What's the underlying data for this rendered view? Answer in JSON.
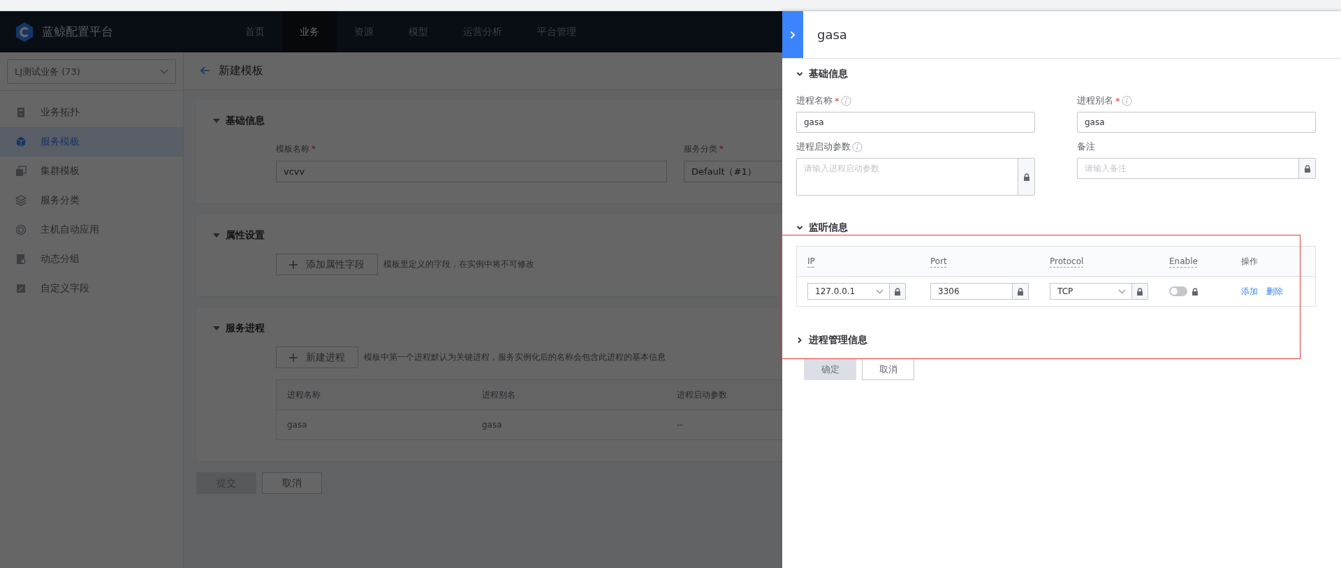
{
  "app": {
    "logo_text": "蓝鲸配置平台",
    "nav": [
      {
        "label": "首页",
        "selected": false
      },
      {
        "label": "业务",
        "selected": true
      },
      {
        "label": "资源",
        "selected": false
      },
      {
        "label": "模型",
        "selected": false
      },
      {
        "label": "运营分析",
        "selected": false
      },
      {
        "label": "平台管理",
        "selected": false
      }
    ]
  },
  "sidebar": {
    "business_select": "LJ测试业务 (73)",
    "items": [
      {
        "label": "业务拓扑",
        "selected": false
      },
      {
        "label": "服务模板",
        "selected": true
      },
      {
        "label": "集群模板",
        "selected": false
      },
      {
        "label": "服务分类",
        "selected": false
      },
      {
        "label": "主机自动应用",
        "selected": false
      },
      {
        "label": "动态分组",
        "selected": false
      },
      {
        "label": "自定义字段",
        "selected": false
      }
    ]
  },
  "page": {
    "title": "新建模板",
    "basic": {
      "title": "基础信息",
      "expanded": true,
      "fields": [
        {
          "label": "模板名称",
          "mark": "*",
          "value": "vcvv"
        },
        {
          "label": "服务分类",
          "mark": "*",
          "value": "Default（#1）"
        }
      ]
    },
    "attributes": {
      "title": "属性设置",
      "expanded": true,
      "button": "添加属性字段",
      "hint": "模板里定义的字段，在实例中将不可修改"
    },
    "processes": {
      "title": "服务进程",
      "expanded": true,
      "button": "新建进程",
      "hint": "模板中第一个进程默认为关键进程，服务实例化后的名称会包含此进程的基本信息",
      "columns": [
        "进程名称",
        "进程别名",
        "进程启动参数"
      ],
      "rows": [
        [
          "gasa",
          "gasa",
          "--"
        ]
      ]
    },
    "actions": [
      {
        "label": "提交",
        "disabled": true
      },
      {
        "label": "取消",
        "disabled": false
      }
    ]
  },
  "drawer": {
    "title": "gasa",
    "basic": {
      "title": "基础信息",
      "expanded": true,
      "fields": [
        {
          "label": "进程名称",
          "mark": "*",
          "info": true,
          "value": "gasa",
          "locked": false,
          "multiline": false
        },
        {
          "label": "进程别名",
          "mark": "*",
          "info": true,
          "value": "gasa",
          "locked": false,
          "multiline": false
        },
        {
          "label": "进程启动参数",
          "info": true,
          "placeholder": "请输入进程启动参数",
          "locked": true,
          "multiline": true
        },
        {
          "label": "备注",
          "info": false,
          "placeholder": "请输入备注",
          "locked": true,
          "multiline": false
        }
      ]
    },
    "listen": {
      "title": "监听信息",
      "expanded": true,
      "columns": [
        {
          "label": "IP",
          "tip": true
        },
        {
          "label": "Port",
          "tip": true
        },
        {
          "label": "Protocol",
          "tip": true
        },
        {
          "label": "Enable",
          "tip": true
        },
        {
          "label": "操作",
          "tip": false
        }
      ],
      "rows": [
        {
          "ip": "127.0.0.1",
          "port": "3306",
          "protocol": "TCP",
          "enabled": false,
          "actions": [
            "添加",
            "删除"
          ]
        }
      ]
    },
    "process_management": {
      "title": "进程管理信息",
      "expanded": false
    },
    "buttons": [
      {
        "label": "确定",
        "disabled": true
      },
      {
        "label": "取消",
        "disabled": false
      }
    ]
  }
}
